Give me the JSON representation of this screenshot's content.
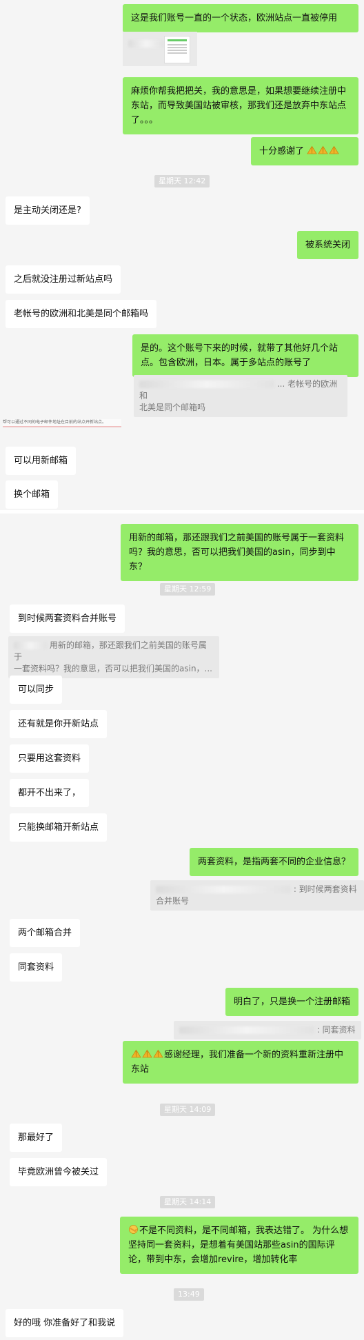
{
  "chat": {
    "m1": "这是我们账号一直的一个状态，欧洲站点一直被停用",
    "m2": "麻烦你帮我把把关，我的意思是，如果想要继续注册中东站，而导致美国站被审核，那我们还是放弃中东站点了。。。",
    "m3": "十分感谢了",
    "t1": "星期天 12:42",
    "m4": "是主动关闭还是?",
    "m5": "被系统关闭",
    "m6": "之后就没注册过新站点吗",
    "m7": "老帐号的欧洲和北美是同个邮箱吗",
    "m8": "是的。这个账号下来的时候，就带了其他好几个站点。包含欧洲，日本。属于多站点的账号了",
    "q1a": "... 老帐号的欧洲和",
    "q1b": "北美是同个邮箱吗",
    "strip": "帮可以通过不同的电子邮件地址在目前的站点开新站点。",
    "m9": "可以用新邮箱",
    "m10": "换个邮箱",
    "m11": "用新的邮箱，那还跟我们之前美国的账号属于一套资料吗？我的意思，否可以把我们美国的asin，同步到中东？",
    "t2": "星期天 12:59",
    "m12": "到时候两套资料合并账号",
    "q2a": "用新的邮箱，那还跟我们之前美国的账号属于",
    "q2b": "一套资料吗？我的意思，否可以把我们美国的asin，...",
    "m13": "可以同步",
    "m14": "还有就是你开新站点",
    "m15": "只要用这套资料",
    "m16": "都开不出来了，",
    "m17": "只能换邮箱开新站点",
    "m18": "两套资料，是指两套不同的企业信息？",
    "q3a": ": 到时候两套资料",
    "q3b": "合并账号",
    "m19": "两个邮箱合并",
    "m20": "同套资料",
    "m21": "明白了，只是换一个注册邮箱",
    "q4": ": 同套资料",
    "m22": "感谢经理，我们准备一个新的资料重新注册中东站",
    "t3": "星期天 14:09",
    "m23": "那最好了",
    "m24": "毕竟欧洲曾今被关过",
    "t4": "星期天 14:14",
    "m25": "不是不同资料，是不同邮箱，我表达错了。 为什么想坚持同一套资料，是想着有美国站那些asin的国际评论，带到中东，会增加revire，增加转化率",
    "t5": "13:49",
    "m26": "好的哦 你准备好了和我说"
  },
  "colors": {
    "outgoing": "#95ec69",
    "incoming": "#ffffff",
    "background": "#f5f5f5"
  },
  "icons": {
    "thanks": "prayer-hands-icon",
    "facepalm": "facepalm-emoji-icon"
  }
}
